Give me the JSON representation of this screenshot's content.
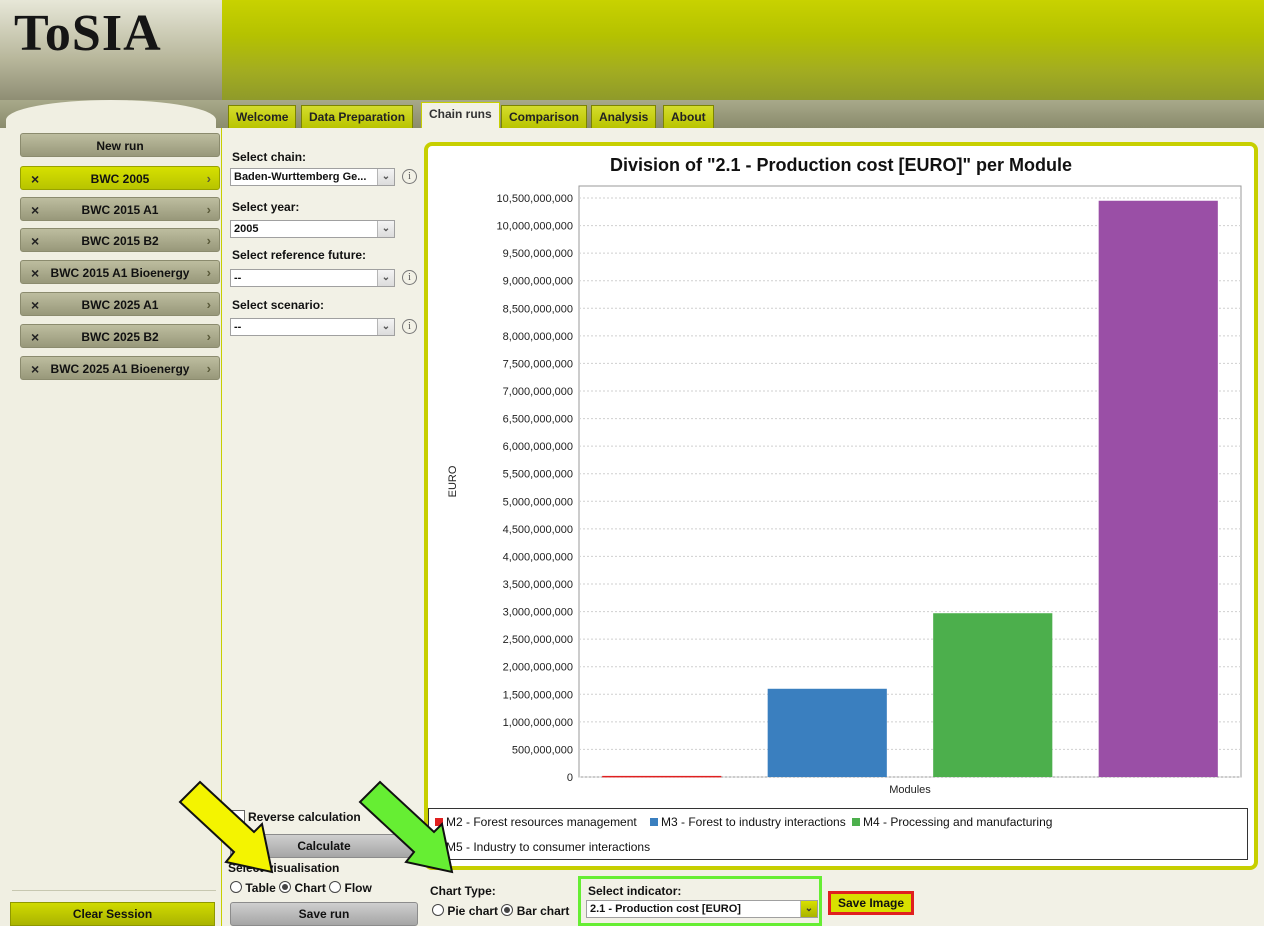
{
  "header": {
    "logo": "ToSIA"
  },
  "tabs": [
    "Welcome",
    "Data Preparation",
    "Chain runs",
    "Comparison",
    "Analysis",
    "About"
  ],
  "active_tab": "Chain runs",
  "sidebar": {
    "new_run": "New run",
    "runs": [
      "BWC 2005",
      "BWC 2015 A1",
      "BWC 2015 B2",
      "BWC 2015 A1 Bioenergy",
      "BWC 2025 A1",
      "BWC 2025 B2",
      "BWC 2025 A1 Bioenergy"
    ],
    "active_run": "BWC 2005",
    "remove_glyph": "×",
    "arrow_glyph": "›",
    "clear_session": "Clear Session"
  },
  "controls": {
    "select_chain_label": "Select chain:",
    "select_chain_value": "Baden-Wurttemberg Ge...",
    "select_year_label": "Select year:",
    "select_year_value": "2005",
    "select_ref_future_label": "Select reference future:",
    "select_ref_future_value": "--",
    "select_scenario_label": "Select scenario:",
    "select_scenario_value": "--",
    "reverse_calc": "Reverse calculation",
    "calculate": "Calculate",
    "select_visualisation": "Select visualisation",
    "vis_options": [
      "Table",
      "Chart",
      "Flow"
    ],
    "vis_selected": "Chart",
    "save_run": "Save run",
    "chart_type_label": "Chart Type:",
    "chart_types": [
      "Pie chart",
      "Bar chart"
    ],
    "chart_type_selected": "Bar chart",
    "select_indicator_label": "Select indicator:",
    "select_indicator_value": "2.1 - Production cost [EURO]",
    "save_image": "Save Image",
    "info_glyph": "i",
    "dropdown_glyph": "⌄"
  },
  "chart_data": {
    "type": "bar",
    "title": "Division of \"2.1 - Production cost [EURO]\" per Module",
    "xlabel": "Modules",
    "ylabel": "EURO",
    "ylim": [
      0,
      10500000000
    ],
    "y_tick_step": 500000000,
    "grid": true,
    "legend_position": "bottom",
    "categories": [
      "M2 - Forest resources management",
      "M3 - Forest to industry interactions",
      "M4 - Processing and manufacturing",
      "M5 - Industry to consumer interactions"
    ],
    "values": [
      20000000,
      1600000000,
      2970000000,
      10450000000
    ],
    "colors": [
      "#e02020",
      "#3a7fbf",
      "#4caf4c",
      "#9a4fa6"
    ]
  }
}
